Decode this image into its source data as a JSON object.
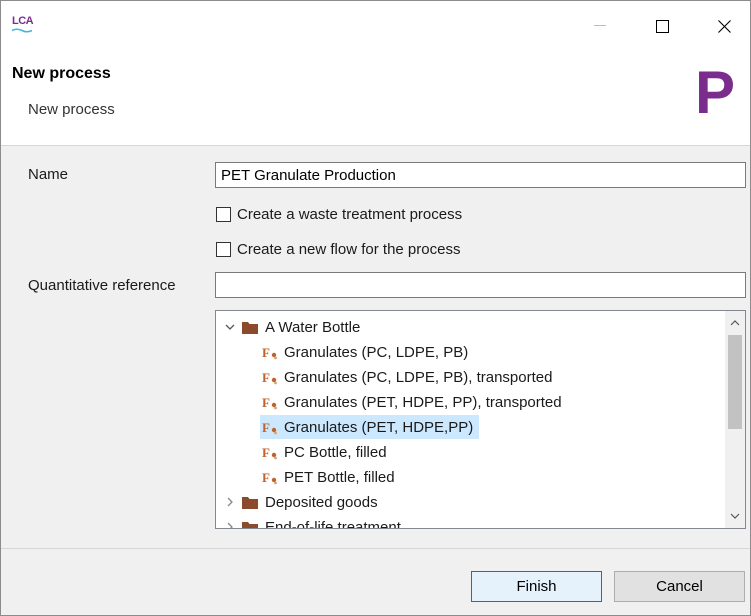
{
  "titlebar": {
    "app_logo_text": "LCA",
    "icons": {
      "minimize": "minimize-icon",
      "maximize": "maximize-icon",
      "close": "close-icon"
    }
  },
  "header": {
    "title": "New process",
    "subtitle": "New process",
    "banner_letter": "P",
    "banner_color": "#7b2d8e"
  },
  "form": {
    "name_label": "Name",
    "name_value": "PET Granulate Production",
    "waste_checkbox_label": "Create a waste treatment process",
    "waste_checked": false,
    "new_flow_checkbox_label": "Create a new flow for the process",
    "new_flow_checked": false,
    "quant_ref_label": "Quantitative reference",
    "quant_ref_value": ""
  },
  "tree": {
    "items": [
      {
        "label": "A Water Bottle",
        "type": "folder",
        "expanded": true
      },
      {
        "label": "Granulates (PC, LDPE, PB)",
        "type": "flow",
        "selected": false
      },
      {
        "label": "Granulates (PC, LDPE, PB), transported",
        "type": "flow",
        "selected": false
      },
      {
        "label": "Granulates (PET, HDPE, PP), transported",
        "type": "flow",
        "selected": false
      },
      {
        "label": "Granulates (PET, HDPE,PP)",
        "type": "flow",
        "selected": true
      },
      {
        "label": "PC Bottle, filled",
        "type": "flow",
        "selected": false
      },
      {
        "label": "PET Bottle, filled",
        "type": "flow",
        "selected": false
      },
      {
        "label": "Deposited goods",
        "type": "folder",
        "expanded": false
      },
      {
        "label": "End-of-life treatment",
        "type": "folder",
        "expanded": false
      }
    ]
  },
  "buttons": {
    "finish": "Finish",
    "cancel": "Cancel"
  },
  "colors": {
    "folder": "#8b4a2b",
    "selection": "#cce8ff",
    "accent": "#0078d7"
  }
}
